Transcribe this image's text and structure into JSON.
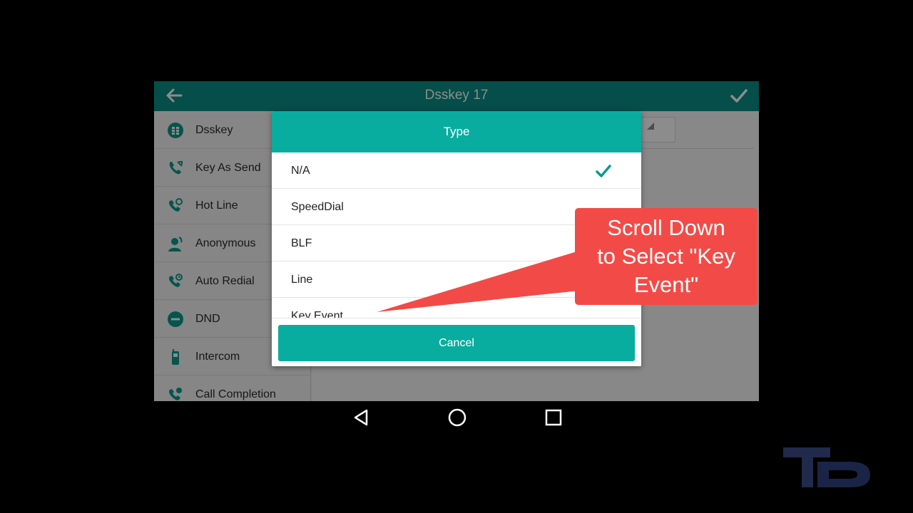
{
  "window": {
    "title": "Dsskey 17"
  },
  "titlebar": {
    "back_icon": "arrow-left-icon",
    "confirm_icon": "check-icon"
  },
  "sidebar": {
    "items": [
      {
        "label": "Dsskey",
        "icon": "dsskey-grid-icon"
      },
      {
        "label": "Key As Send",
        "icon": "phone-send-icon"
      },
      {
        "label": "Hot Line",
        "icon": "phone-hotline-icon"
      },
      {
        "label": "Anonymous",
        "icon": "anonymous-user-icon"
      },
      {
        "label": "Auto Redial",
        "icon": "phone-redial-icon"
      },
      {
        "label": "DND",
        "icon": "dnd-icon"
      },
      {
        "label": "Intercom",
        "icon": "intercom-handset-icon"
      },
      {
        "label": "Call Completion",
        "icon": "call-completion-icon"
      }
    ]
  },
  "dialog": {
    "title": "Type",
    "options": [
      {
        "label": "N/A",
        "selected": true
      },
      {
        "label": "SpeedDial",
        "selected": false
      },
      {
        "label": "BLF",
        "selected": false
      },
      {
        "label": "Line",
        "selected": false
      },
      {
        "label": "Key Event",
        "selected": false
      }
    ],
    "cancel_label": "Cancel"
  },
  "callout": {
    "line1": "Scroll Down",
    "line2": "to Select \"Key",
    "line3": "Event\""
  },
  "navbar": {
    "back_icon": "nav-back-icon",
    "home_icon": "nav-home-icon",
    "recents_icon": "nav-recents-icon"
  },
  "colors": {
    "teal_dark": "#0a8f85",
    "teal": "#08ada0",
    "callout_red": "#f24b47"
  }
}
